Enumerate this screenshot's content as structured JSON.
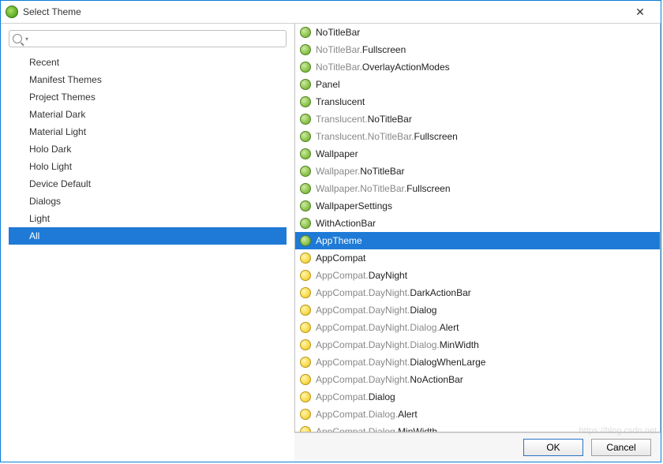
{
  "window": {
    "title": "Select Theme",
    "close_glyph": "✕"
  },
  "search": {
    "placeholder": ""
  },
  "categories": [
    {
      "label": "Recent",
      "selected": false
    },
    {
      "label": "Manifest Themes",
      "selected": false
    },
    {
      "label": "Project Themes",
      "selected": false
    },
    {
      "label": "Material Dark",
      "selected": false
    },
    {
      "label": "Material Light",
      "selected": false
    },
    {
      "label": "Holo Dark",
      "selected": false
    },
    {
      "label": "Holo Light",
      "selected": false
    },
    {
      "label": "Device Default",
      "selected": false
    },
    {
      "label": "Dialogs",
      "selected": false
    },
    {
      "label": "Light",
      "selected": false
    },
    {
      "label": "All",
      "selected": true
    }
  ],
  "themes": [
    {
      "icon": "green",
      "gray": "",
      "black": "NoTitleBar",
      "selected": false
    },
    {
      "icon": "green",
      "gray": "NoTitleBar.",
      "black": "Fullscreen",
      "selected": false
    },
    {
      "icon": "green",
      "gray": "NoTitleBar.",
      "black": "OverlayActionModes",
      "selected": false
    },
    {
      "icon": "green",
      "gray": "",
      "black": "Panel",
      "selected": false
    },
    {
      "icon": "green",
      "gray": "",
      "black": "Translucent",
      "selected": false
    },
    {
      "icon": "green",
      "gray": "Translucent.",
      "black": "NoTitleBar",
      "selected": false
    },
    {
      "icon": "green",
      "gray": "Translucent.NoTitleBar.",
      "black": "Fullscreen",
      "selected": false
    },
    {
      "icon": "green",
      "gray": "",
      "black": "Wallpaper",
      "selected": false
    },
    {
      "icon": "green",
      "gray": "Wallpaper.",
      "black": "NoTitleBar",
      "selected": false
    },
    {
      "icon": "green",
      "gray": "Wallpaper.NoTitleBar.",
      "black": "Fullscreen",
      "selected": false
    },
    {
      "icon": "green",
      "gray": "",
      "black": "WallpaperSettings",
      "selected": false
    },
    {
      "icon": "green",
      "gray": "",
      "black": "WithActionBar",
      "selected": false
    },
    {
      "icon": "green",
      "gray": "",
      "black": "AppTheme",
      "selected": true
    },
    {
      "icon": "yellow",
      "gray": "",
      "black": "AppCompat",
      "selected": false
    },
    {
      "icon": "yellow",
      "gray": "AppCompat.",
      "black": "DayNight",
      "selected": false
    },
    {
      "icon": "yellow",
      "gray": "AppCompat.DayNight.",
      "black": "DarkActionBar",
      "selected": false
    },
    {
      "icon": "yellow",
      "gray": "AppCompat.DayNight.",
      "black": "Dialog",
      "selected": false
    },
    {
      "icon": "yellow",
      "gray": "AppCompat.DayNight.Dialog.",
      "black": "Alert",
      "selected": false
    },
    {
      "icon": "yellow",
      "gray": "AppCompat.DayNight.Dialog.",
      "black": "MinWidth",
      "selected": false
    },
    {
      "icon": "yellow",
      "gray": "AppCompat.DayNight.",
      "black": "DialogWhenLarge",
      "selected": false
    },
    {
      "icon": "yellow",
      "gray": "AppCompat.DayNight.",
      "black": "NoActionBar",
      "selected": false
    },
    {
      "icon": "yellow",
      "gray": "AppCompat.",
      "black": "Dialog",
      "selected": false
    },
    {
      "icon": "yellow",
      "gray": "AppCompat.Dialog.",
      "black": "Alert",
      "selected": false
    },
    {
      "icon": "yellow",
      "gray": "AppCompat.Dialog.",
      "black": "MinWidth",
      "selected": false
    }
  ],
  "buttons": {
    "ok": "OK",
    "cancel": "Cancel"
  },
  "watermark": "https://blog.csdn.net"
}
